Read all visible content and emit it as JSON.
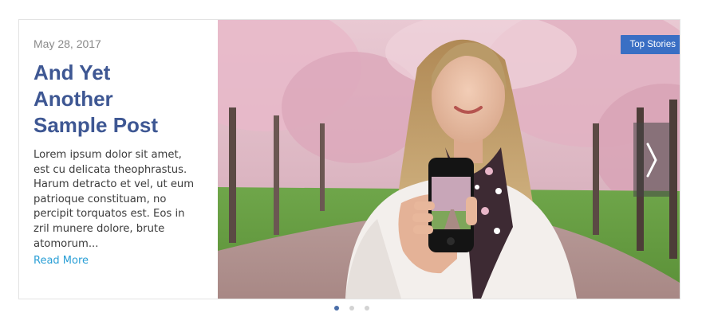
{
  "post": {
    "date": "May 28, 2017",
    "title": "And Yet Another Sample Post",
    "excerpt": "Lorem ipsum dolor sit amet, est cu delicata theophrastus. Harum detracto et vel, ut eum patrioque constituam, no percipit torquatos est. Eos in zril munere dolore, brute atomorum...",
    "read_more": "Read More"
  },
  "badge": {
    "label": "Top Stories"
  },
  "slider": {
    "next_icon": "chevron-right-icon",
    "dots": 3,
    "active_dot": 1
  },
  "colors": {
    "title": "#3e5793",
    "link": "#2a9fd6",
    "badge": "#3a6fc4",
    "active_dot": "#4a6ea8"
  }
}
